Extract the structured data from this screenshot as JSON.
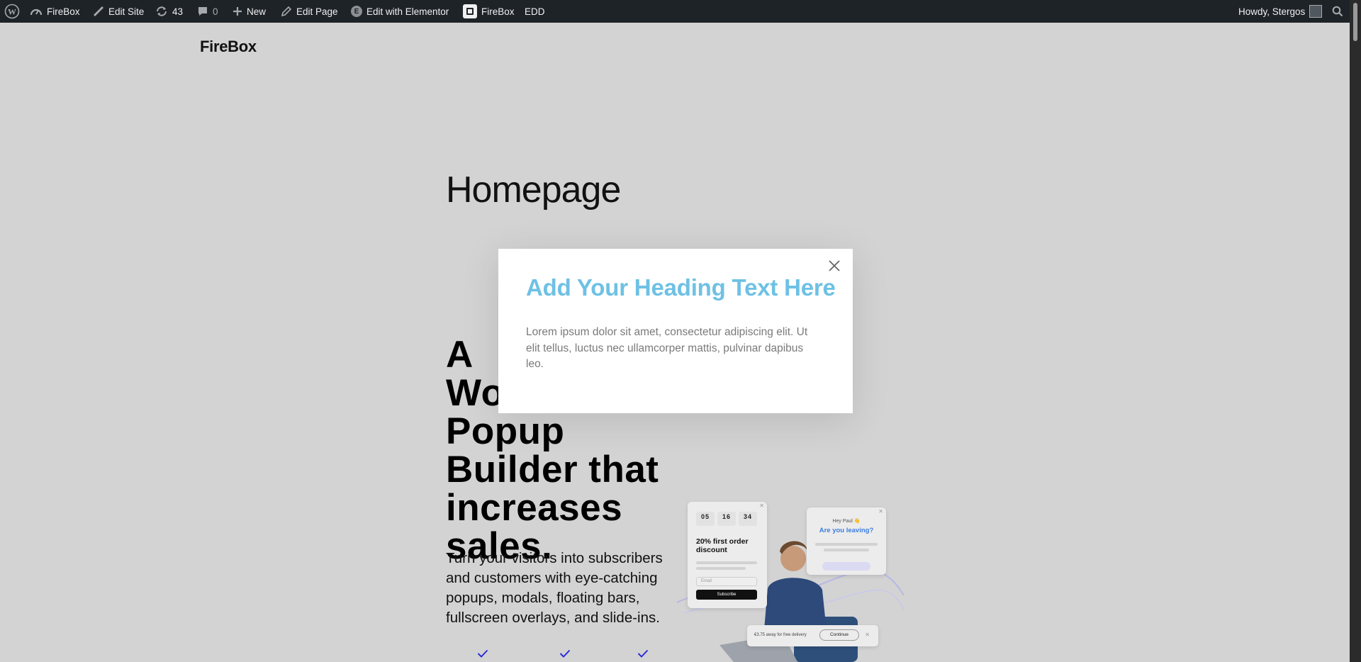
{
  "adminbar": {
    "site_name": "FireBox",
    "edit_site": "Edit Site",
    "updates_count": "43",
    "comments_count": "0",
    "new_label": "New",
    "edit_page": "Edit Page",
    "edit_with_elementor": "Edit with Elementor",
    "elementor_badge": "E",
    "firebox_menu": "FireBox",
    "edd_menu": "EDD",
    "greeting": "Howdy, Stergos"
  },
  "site": {
    "title": "FireBox"
  },
  "page": {
    "title": "Homepage",
    "hero_heading": "A WordPress Popup Builder that increases sales.",
    "hero_sub": "Turn your visitors into subscribers and customers with eye-catching popups, modals, floating bars, fullscreen overlays, and slide-ins."
  },
  "illustration": {
    "countdown": [
      "05",
      "16",
      "34"
    ],
    "offer_text": "20% first order discount",
    "email_placeholder": "Email",
    "subscribe_label": "Subscribe",
    "hey_text": "Hey Paul 👋",
    "leaving_text": "Are you leaving?",
    "delivery_text": "€3.75 away for free delivery",
    "continue_label": "Continue"
  },
  "popup": {
    "heading": "Add Your Heading Text Here",
    "body": "Lorem ipsum dolor sit amet, consectetur adipiscing elit. Ut elit tellus, luctus nec ullamcorper mattis, pulvinar dapibus leo."
  },
  "colors": {
    "admin_bar": "#1d2327",
    "overlay_bg": "#d3d3d3",
    "popup_heading": "#6ec1e4",
    "popup_text": "#7a7a7a",
    "check_accent": "#2b2bd9"
  }
}
